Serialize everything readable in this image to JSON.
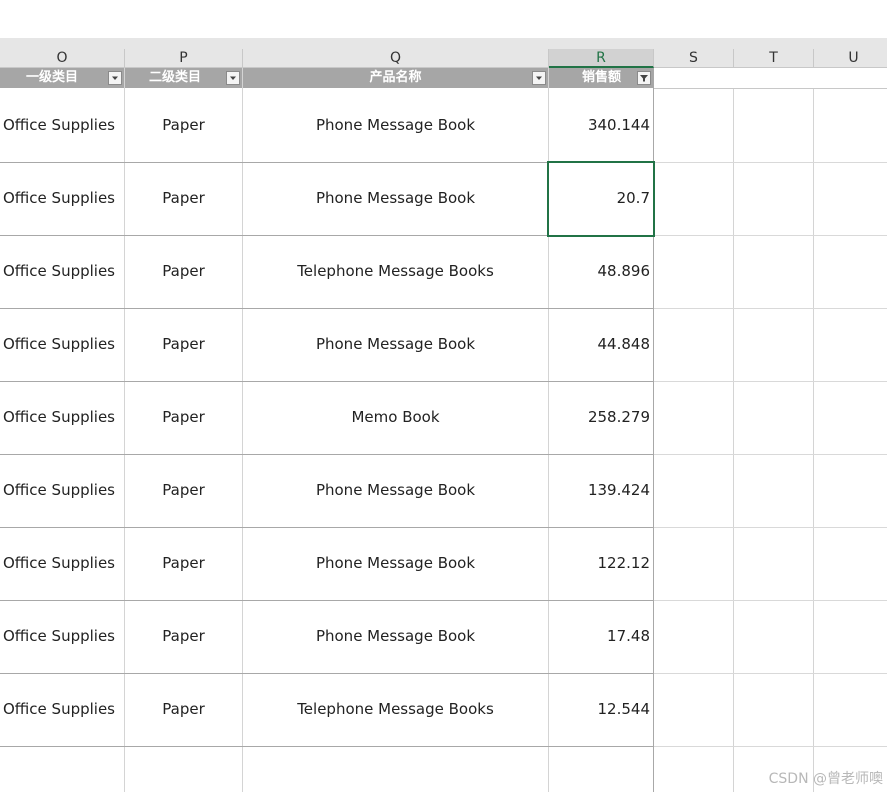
{
  "columns": [
    {
      "letter": "O"
    },
    {
      "letter": "P"
    },
    {
      "letter": "Q"
    },
    {
      "letter": "R"
    },
    {
      "letter": "S"
    },
    {
      "letter": "T"
    },
    {
      "letter": "U"
    }
  ],
  "selected_column": "R",
  "headers": {
    "o": "一级类目",
    "p": "二级类目",
    "q": "产品名称",
    "r": "销售额"
  },
  "rows": [
    {
      "category": "Office Supplies",
      "subcategory": "Paper",
      "product": "Phone Message Book",
      "sales": "340.144"
    },
    {
      "category": "Office Supplies",
      "subcategory": "Paper",
      "product": "Phone Message Book",
      "sales": "20.7"
    },
    {
      "category": "Office Supplies",
      "subcategory": "Paper",
      "product": "Telephone Message Books",
      "sales": "48.896"
    },
    {
      "category": "Office Supplies",
      "subcategory": "Paper",
      "product": "Phone Message Book",
      "sales": "44.848"
    },
    {
      "category": "Office Supplies",
      "subcategory": "Paper",
      "product": "Memo Book",
      "sales": "258.279"
    },
    {
      "category": "Office Supplies",
      "subcategory": "Paper",
      "product": "Phone Message Book",
      "sales": "139.424"
    },
    {
      "category": "Office Supplies",
      "subcategory": "Paper",
      "product": "Phone Message Book",
      "sales": "122.12"
    },
    {
      "category": "Office Supplies",
      "subcategory": "Paper",
      "product": "Phone Message Book",
      "sales": "17.48"
    },
    {
      "category": "Office Supplies",
      "subcategory": "Paper",
      "product": "Telephone Message Books",
      "sales": "12.544"
    }
  ],
  "active_cell_row": 1,
  "icons": {
    "filter_dropdown": "chevron-down-icon",
    "filter_active": "filter-funnel-icon"
  },
  "colors": {
    "selection_accent": "#217346",
    "header_fill": "#a6a6a6"
  },
  "watermark": "CSDN @曾老师噢"
}
